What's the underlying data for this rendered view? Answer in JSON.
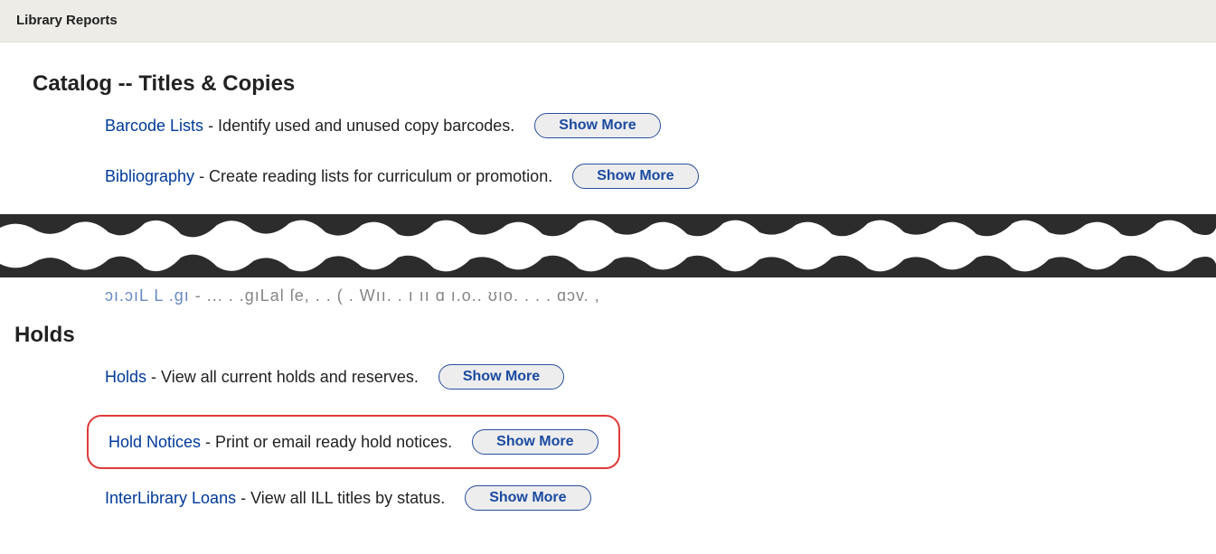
{
  "header": {
    "title": "Library Reports"
  },
  "catalog": {
    "heading": "Catalog -- Titles & Copies",
    "rows": [
      {
        "link": "Barcode Lists",
        "desc": " - Identify used and unused copy barcodes.",
        "btn": "Show More"
      },
      {
        "link": "Bibliography",
        "desc": " - Create reading lists for curriculum or promotion.",
        "btn": "Show More"
      }
    ]
  },
  "partial": {
    "frag_link": "ɔı.ɔıL L .ɡı",
    "frag_text": "        - ... . .ɡıLal ſe,  .   . ( .    Wıı.    .   ı  ıı ɑ ı.o..  ʊıo.  .  .  .   ɑɔv.  ,"
  },
  "holds": {
    "heading": "Holds",
    "rows": [
      {
        "link": "Holds",
        "desc": " - View all current holds and reserves.",
        "btn": "Show More"
      },
      {
        "link": "Hold Notices",
        "desc": " - Print or email ready hold notices.",
        "btn": "Show More"
      },
      {
        "link": "InterLibrary Loans",
        "desc": " - View all ILL titles by status.",
        "btn": "Show More"
      }
    ]
  }
}
